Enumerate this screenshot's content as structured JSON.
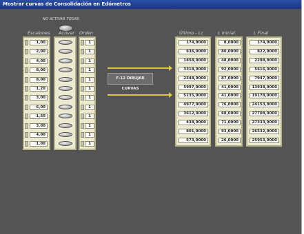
{
  "window": {
    "title": "Mostrar curvas de Consolidación en Edómetros"
  },
  "toggle_all": {
    "label": "NO ACTIVAR TODAS"
  },
  "headers": {
    "escalones": "Escalones",
    "activar": "Activar",
    "orden": "Orden",
    "ultimo": "Último - Lc",
    "linicial": "L Inicial",
    "lfinal": "L Final"
  },
  "escalones": [
    "1,00",
    "2,00",
    "4,00",
    "8,00",
    "8,00",
    "1,20",
    "3,00",
    "6,00",
    "1,50",
    "3,00",
    "4,00",
    "1,00"
  ],
  "orden": [
    "1",
    "1",
    "1",
    "1",
    "1",
    "1",
    "1",
    "1",
    "1",
    "1",
    "1",
    "1"
  ],
  "ultimo": [
    "174,0000",
    "636,0000",
    "1458,0000",
    "3318,0000",
    "2348,0000",
    "5997,0000",
    "5235,0000",
    "4977,0000",
    "3612,0000",
    "438,0000",
    "801,0000",
    "573,0000"
  ],
  "linicial": [
    "8,0000",
    "86,0000",
    "48,0000",
    "92,0000",
    "87,0000",
    "41,0000",
    "41,0000",
    "76,0000",
    "68,0000",
    "71,0000",
    "93,0000",
    "26,0000"
  ],
  "lfinal": [
    "174,0000",
    "822,0000",
    "2298,0000",
    "5616,0000",
    "7947,0000",
    "13938,0000",
    "19178,0000",
    "24153,0000",
    "27708,0000",
    "27333,0000",
    "26532,0000",
    "25953,0000"
  ],
  "draw_button": "F-12  DIBUJAR CURVAS"
}
